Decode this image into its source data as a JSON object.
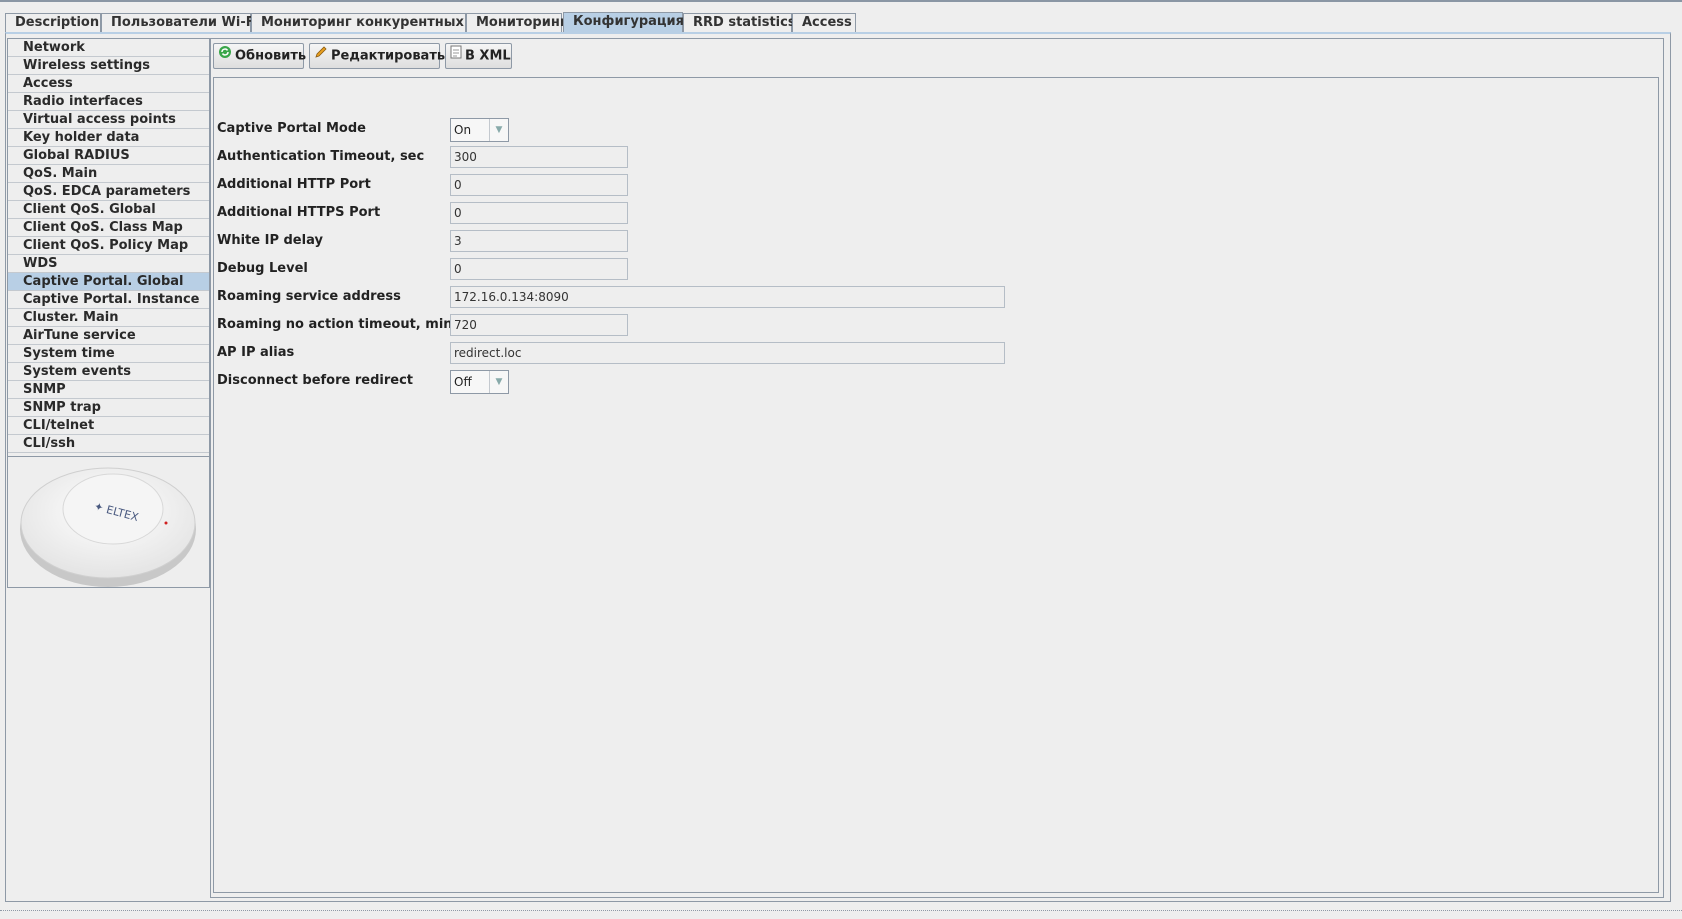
{
  "tabs": [
    "Description",
    "Пользователи Wi-Fi",
    "Мониторинг конкурентных ТД",
    "Мониторинг",
    "Конфигурация",
    "RRD statistics",
    "Access"
  ],
  "active_tab": "Конфигурация",
  "sidebar": {
    "items": [
      "Network",
      "Wireless settings",
      "Access",
      "Radio interfaces",
      "Virtual access points",
      "Key holder data",
      "Global RADIUS",
      "QoS. Main",
      "QoS. EDCA parameters",
      "Client QoS. Global",
      "Client QoS. Class Map",
      "Client QoS. Policy Map",
      "WDS",
      "Captive Portal. Global",
      "Captive Portal. Instance",
      "Cluster. Main",
      "AirTune service",
      "System time",
      "System events",
      "SNMP",
      "SNMP trap",
      "CLI/telnet",
      "CLI/ssh"
    ],
    "active_item": "Captive Portal. Global",
    "device_logo": "ELTEX"
  },
  "toolbar": {
    "refresh_label": "Обновить",
    "edit_label": "Редактировать",
    "xml_label": "В XML"
  },
  "form": {
    "captive_portal_mode": {
      "label": "Captive Portal Mode",
      "value": "On"
    },
    "auth_timeout": {
      "label": "Authentication Timeout, sec",
      "value": "300"
    },
    "http_port": {
      "label": "Additional HTTP Port",
      "value": "0"
    },
    "https_port": {
      "label": "Additional HTTPS Port",
      "value": "0"
    },
    "white_ip_delay": {
      "label": "White IP delay",
      "value": "3"
    },
    "debug_level": {
      "label": "Debug Level",
      "value": "0"
    },
    "roaming_address": {
      "label": "Roaming service address",
      "value": "172.16.0.134:8090"
    },
    "roaming_timeout": {
      "label": "Roaming no action timeout, min",
      "value": "720"
    },
    "ap_ip_alias": {
      "label": "AP IP alias",
      "value": "redirect.loc"
    },
    "disconnect_before_redirect": {
      "label": "Disconnect before redirect",
      "value": "Off"
    }
  },
  "colors": {
    "active_tab": "#b8cfe5",
    "border": "#8e99a6",
    "background": "#eeeeee"
  }
}
